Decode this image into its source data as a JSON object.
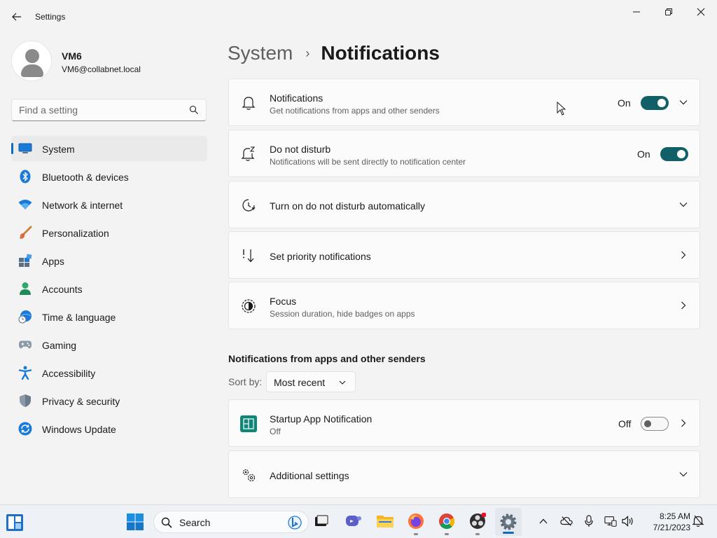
{
  "window": {
    "title": "Settings"
  },
  "profile": {
    "name": "VM6",
    "email": "VM6@collabnet.local"
  },
  "search": {
    "placeholder": "Find a setting"
  },
  "nav": {
    "items": [
      {
        "label": "System",
        "icon": "system-icon",
        "active": true
      },
      {
        "label": "Bluetooth & devices",
        "icon": "bluetooth-icon"
      },
      {
        "label": "Network & internet",
        "icon": "wifi-icon"
      },
      {
        "label": "Personalization",
        "icon": "brush-icon"
      },
      {
        "label": "Apps",
        "icon": "apps-icon"
      },
      {
        "label": "Accounts",
        "icon": "person-icon"
      },
      {
        "label": "Time & language",
        "icon": "clock-globe-icon"
      },
      {
        "label": "Gaming",
        "icon": "gamepad-icon"
      },
      {
        "label": "Accessibility",
        "icon": "accessibility-icon"
      },
      {
        "label": "Privacy & security",
        "icon": "shield-icon"
      },
      {
        "label": "Windows Update",
        "icon": "update-icon"
      }
    ]
  },
  "breadcrumb": {
    "parent": "System",
    "separator": "›",
    "current": "Notifications"
  },
  "settings": {
    "notifications": {
      "title": "Notifications",
      "subtitle": "Get notifications from apps and other senders",
      "state": "On"
    },
    "do_not_disturb": {
      "title": "Do not disturb",
      "subtitle": "Notifications will be sent directly to notification center",
      "state": "On"
    },
    "dnd_auto": {
      "title": "Turn on do not disturb automatically"
    },
    "priority": {
      "title": "Set priority notifications"
    },
    "focus": {
      "title": "Focus",
      "subtitle": "Session duration, hide badges on apps"
    }
  },
  "apps_section": {
    "heading": "Notifications from apps and other senders",
    "sort_label": "Sort by:",
    "sort_value": "Most recent",
    "startup_app": {
      "title": "Startup App Notification",
      "subtitle": "Off",
      "state": "Off"
    },
    "additional": {
      "title": "Additional settings"
    }
  },
  "taskbar": {
    "search_label": "Search",
    "time": "8:25 AM",
    "date": "7/21/2023"
  },
  "colors": {
    "accent": "#0f6cbd",
    "toggle_on": "#116068",
    "background": "#f3f3f3",
    "card": "#fbfbfb"
  }
}
